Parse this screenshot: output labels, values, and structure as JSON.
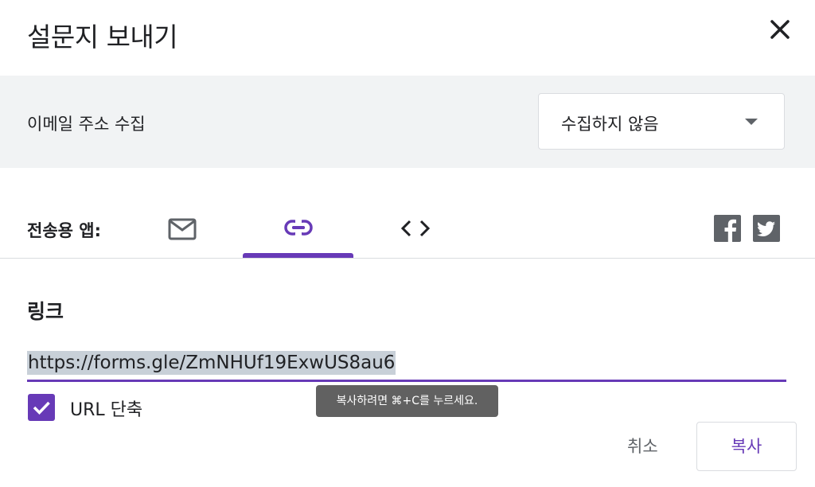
{
  "dialog": {
    "title": "설문지 보내기",
    "close_icon": "close-icon"
  },
  "email_collection": {
    "label": "이메일 주소 수집",
    "selected": "수집하지 않음",
    "arrow_icon": "dropdown-arrow-icon"
  },
  "send_via": {
    "label": "전송용 앱:",
    "tabs": [
      {
        "name": "email",
        "icon": "mail-icon",
        "active": false
      },
      {
        "name": "link",
        "icon": "link-icon",
        "active": true
      },
      {
        "name": "embed",
        "icon": "code-icon",
        "active": false
      }
    ],
    "social": [
      {
        "name": "facebook",
        "icon": "facebook-icon"
      },
      {
        "name": "twitter",
        "icon": "twitter-icon"
      }
    ]
  },
  "link_section": {
    "title": "링크",
    "url": "https://forms.gle/ZmNHUf19ExwUS8au6",
    "shorten_label": "URL 단축",
    "shorten_checked": true,
    "tooltip": "복사하려면 ⌘+C를 누르세요."
  },
  "actions": {
    "cancel_label": "취소",
    "copy_label": "복사"
  },
  "colors": {
    "accent": "#673ab7",
    "band": "#f1f3f4",
    "icon_gray": "#5f6368",
    "tooltip_bg": "#616161"
  }
}
